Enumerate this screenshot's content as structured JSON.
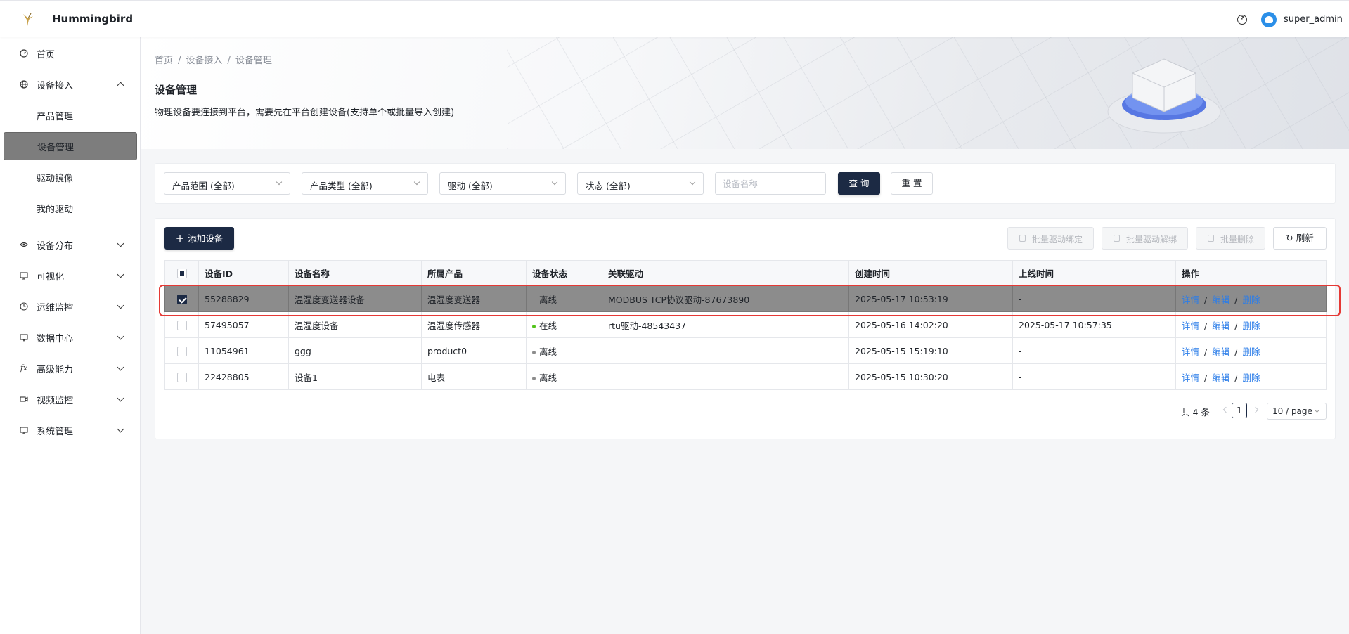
{
  "header": {
    "brand": "Hummingbird",
    "username": "super_admin",
    "help_icon": "?"
  },
  "sidebar": {
    "items": [
      {
        "label": "首页",
        "icon": "dashboard-icon"
      },
      {
        "label": "设备接入",
        "icon": "globe-icon",
        "expanded": true,
        "children": [
          "产品管理",
          "设备管理",
          "驱动镜像",
          "我的驱动"
        ],
        "active_child": "设备管理"
      },
      {
        "label": "设备分布",
        "icon": "eye-icon"
      },
      {
        "label": "可视化",
        "icon": "monitor-icon"
      },
      {
        "label": "运维监控",
        "icon": "clock-icon"
      },
      {
        "label": "数据中心",
        "icon": "chat-monitor-icon"
      },
      {
        "label": "高级能力",
        "icon": "fx-icon"
      },
      {
        "label": "视频监控",
        "icon": "video-icon"
      },
      {
        "label": "系统管理",
        "icon": "monitor-icon"
      }
    ]
  },
  "breadcrumb": [
    "首页",
    "设备接入",
    "设备管理"
  ],
  "page": {
    "title": "设备管理",
    "description": "物理设备要连接到平台，需要先在平台创建设备(支持单个或批量导入创建)"
  },
  "filters": {
    "product_scope": "产品范围 (全部)",
    "product_type": "产品类型 (全部)",
    "driver": "驱动 (全部)",
    "status": "状态 (全部)",
    "device_name_placeholder": "设备名称",
    "query_label": "查 询",
    "reset_label": "重 置"
  },
  "toolbar": {
    "add_label": "添加设备",
    "bind_label": "批量驱动绑定",
    "unbind_label": "批量驱动解绑",
    "delete_label": "批量删除",
    "refresh_label": "刷新"
  },
  "table": {
    "columns": [
      "设备ID",
      "设备名称",
      "所属产品",
      "设备状态",
      "关联驱动",
      "创建时间",
      "上线时间",
      "操作"
    ],
    "actions": [
      "详情",
      "编辑",
      "删除"
    ],
    "rows": [
      {
        "id": "55288829",
        "name": "温湿度变送器设备",
        "product": "温湿度变送器",
        "status": "离线",
        "status_color": "#8c8c8c",
        "driver": "MODBUS TCP协议驱动-87673890",
        "created": "2025-05-17 10:53:19",
        "online": "-",
        "selected": true
      },
      {
        "id": "57495057",
        "name": "温湿度设备",
        "product": "温湿度传感器",
        "status": "在线",
        "status_color": "#52c41a",
        "driver": "rtu驱动-48543437",
        "created": "2025-05-16 14:02:20",
        "online": "2025-05-17 10:57:35",
        "selected": false
      },
      {
        "id": "11054961",
        "name": "ggg",
        "product": "product0",
        "status": "离线",
        "status_color": "#8c8c8c",
        "driver": "",
        "created": "2025-05-15 15:19:10",
        "online": "-",
        "selected": false
      },
      {
        "id": "22428805",
        "name": "设备1",
        "product": "电表",
        "status": "离线",
        "status_color": "#8c8c8c",
        "driver": "",
        "created": "2025-05-15 10:30:20",
        "online": "-",
        "selected": false
      }
    ]
  },
  "pagination": {
    "total_text": "共 4 条",
    "current_page": "1",
    "page_size": "10 / page"
  },
  "colors": {
    "primary": "#1c2a44",
    "link": "#2b7de9",
    "highlight": "#e53935",
    "online": "#52c41a",
    "offline": "#8c8c8c"
  }
}
